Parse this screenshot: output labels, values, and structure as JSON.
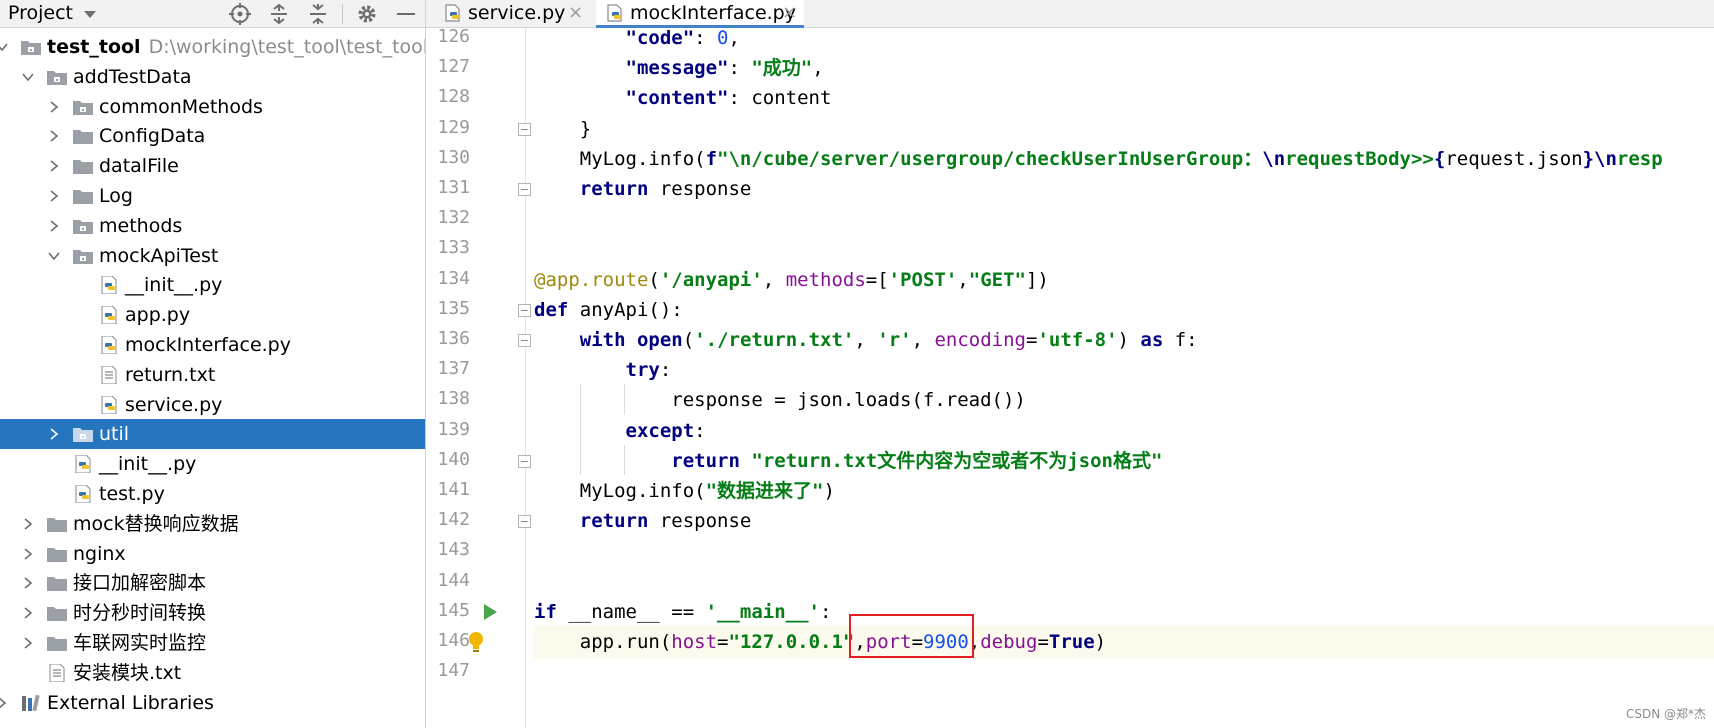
{
  "project_panel": {
    "title": "Project",
    "tree": [
      {
        "label": "test_tool",
        "path": "D:\\working\\test_tool\\test_tool",
        "kind": "module-folder",
        "depth": 0,
        "arrow": "down",
        "bold": true
      },
      {
        "label": "addTestData",
        "kind": "module-folder",
        "depth": 1,
        "arrow": "down"
      },
      {
        "label": "commonMethods",
        "kind": "module-folder",
        "depth": 2,
        "arrow": "right"
      },
      {
        "label": "ConfigData",
        "kind": "folder",
        "depth": 2,
        "arrow": "right"
      },
      {
        "label": "datalFile",
        "kind": "folder",
        "depth": 2,
        "arrow": "right"
      },
      {
        "label": "Log",
        "kind": "folder",
        "depth": 2,
        "arrow": "right"
      },
      {
        "label": "methods",
        "kind": "module-folder",
        "depth": 2,
        "arrow": "right"
      },
      {
        "label": "mockApiTest",
        "kind": "module-folder",
        "depth": 2,
        "arrow": "down"
      },
      {
        "label": "__init__.py",
        "kind": "python-file",
        "depth": 3,
        "arrow": "none"
      },
      {
        "label": "app.py",
        "kind": "python-file",
        "depth": 3,
        "arrow": "none"
      },
      {
        "label": "mockInterface.py",
        "kind": "python-file",
        "depth": 3,
        "arrow": "none"
      },
      {
        "label": "return.txt",
        "kind": "text-file",
        "depth": 3,
        "arrow": "none"
      },
      {
        "label": "service.py",
        "kind": "python-file",
        "depth": 3,
        "arrow": "none"
      },
      {
        "label": "util",
        "kind": "module-folder",
        "depth": 2,
        "arrow": "right",
        "selected": true
      },
      {
        "label": "__init__.py",
        "kind": "python-file",
        "depth": 2,
        "arrow": "none"
      },
      {
        "label": "test.py",
        "kind": "python-file",
        "depth": 2,
        "arrow": "none"
      },
      {
        "label": "mock替换响应数据",
        "kind": "folder",
        "depth": 1,
        "arrow": "right"
      },
      {
        "label": "nginx",
        "kind": "folder",
        "depth": 1,
        "arrow": "right"
      },
      {
        "label": "接口加解密脚本",
        "kind": "folder",
        "depth": 1,
        "arrow": "right"
      },
      {
        "label": "时分秒时间转换",
        "kind": "folder",
        "depth": 1,
        "arrow": "right"
      },
      {
        "label": "车联网实时监控",
        "kind": "folder",
        "depth": 1,
        "arrow": "right"
      },
      {
        "label": "安装模块.txt",
        "kind": "text-file",
        "depth": 1,
        "arrow": "none"
      },
      {
        "label": "External Libraries",
        "kind": "libraries",
        "depth": 0,
        "arrow": "right"
      }
    ]
  },
  "editor": {
    "tabs": [
      {
        "label": "service.py",
        "close": "×",
        "active": false
      },
      {
        "label": "mockInterface.py",
        "close": "×",
        "active": true
      }
    ],
    "line_numbers": [
      "126",
      "127",
      "128",
      "129",
      "130",
      "131",
      "132",
      "133",
      "134",
      "135",
      "136",
      "137",
      "138",
      "139",
      "140",
      "141",
      "142",
      "143",
      "144",
      "145",
      "146",
      "147"
    ],
    "code_lines": [
      [
        {
          "t": "        "
        },
        {
          "c": "sp",
          "t": "\"code\""
        },
        {
          "t": ": "
        },
        {
          "c": "n",
          "t": "0"
        },
        {
          "t": ","
        }
      ],
      [
        {
          "t": "        "
        },
        {
          "c": "sp",
          "t": "\"message\""
        },
        {
          "t": ": "
        },
        {
          "c": "s",
          "t": "\"成功\""
        },
        {
          "t": ","
        }
      ],
      [
        {
          "t": "        "
        },
        {
          "c": "sp",
          "t": "\"content\""
        },
        {
          "t": ": content"
        }
      ],
      [
        {
          "t": "    }"
        }
      ],
      [
        {
          "t": "    MyLog.info("
        },
        {
          "c": "k",
          "t": "f"
        },
        {
          "c": "s",
          "t": "\"\\n/cube/server/usergroup/checkUserInUserGroup："
        },
        {
          "c": "k",
          "t": "\\n"
        },
        {
          "c": "s",
          "t": "requestBody>>"
        },
        {
          "c": "k",
          "t": "{"
        },
        {
          "t": "request.json"
        },
        {
          "c": "k",
          "t": "}\\n"
        },
        {
          "c": "s",
          "t": "resp"
        }
      ],
      [
        {
          "t": "    "
        },
        {
          "c": "k",
          "t": "return"
        },
        {
          "t": " response"
        }
      ],
      [],
      [],
      [
        {
          "c": "d",
          "t": "@app.route"
        },
        {
          "t": "("
        },
        {
          "c": "s",
          "t": "'/anyapi'"
        },
        {
          "t": ", "
        },
        {
          "c": "p",
          "t": "methods"
        },
        {
          "t": "=["
        },
        {
          "c": "s",
          "t": "'POST'"
        },
        {
          "t": ","
        },
        {
          "c": "s",
          "t": "\"GET\""
        },
        {
          "t": "])"
        }
      ],
      [
        {
          "c": "k",
          "t": "def"
        },
        {
          "t": " anyApi():"
        }
      ],
      [
        {
          "t": "    "
        },
        {
          "c": "k",
          "t": "with"
        },
        {
          "t": " "
        },
        {
          "c": "sp",
          "t": "open"
        },
        {
          "t": "("
        },
        {
          "c": "s",
          "t": "'./return.txt'"
        },
        {
          "t": ", "
        },
        {
          "c": "s",
          "t": "'r'"
        },
        {
          "t": ", "
        },
        {
          "c": "p",
          "t": "encoding"
        },
        {
          "t": "="
        },
        {
          "c": "s",
          "t": "'utf-8'"
        },
        {
          "t": ") "
        },
        {
          "c": "k",
          "t": "as"
        },
        {
          "t": " f:"
        }
      ],
      [
        {
          "t": "        "
        },
        {
          "c": "k",
          "t": "try"
        },
        {
          "t": ":"
        }
      ],
      [
        {
          "t": "            response = json.loads(f.read())"
        }
      ],
      [
        {
          "t": "        "
        },
        {
          "c": "k",
          "t": "except"
        },
        {
          "t": ":"
        }
      ],
      [
        {
          "t": "            "
        },
        {
          "c": "k",
          "t": "return"
        },
        {
          "t": " "
        },
        {
          "c": "s",
          "t": "\"return.txt文件内容为空或者不为json格式\""
        }
      ],
      [
        {
          "t": "    MyLog.info("
        },
        {
          "c": "s",
          "t": "\"数据进来了\""
        },
        {
          "t": ")"
        }
      ],
      [
        {
          "t": "    "
        },
        {
          "c": "k",
          "t": "return"
        },
        {
          "t": " response"
        }
      ],
      [],
      [],
      [
        {
          "c": "k",
          "t": "if"
        },
        {
          "t": " __name__ == "
        },
        {
          "c": "s",
          "t": "'__main__'"
        },
        {
          "t": ":"
        }
      ],
      [
        {
          "t": "    app.run("
        },
        {
          "c": "p",
          "t": "host"
        },
        {
          "t": "="
        },
        {
          "c": "s",
          "t": "\"127.0.0.1\""
        },
        {
          "t": ","
        },
        {
          "c": "p",
          "t": "port"
        },
        {
          "t": "="
        },
        {
          "c": "n",
          "t": "9900"
        },
        {
          "t": ","
        },
        {
          "c": "p",
          "t": "debug"
        },
        {
          "t": "="
        },
        {
          "c": "k",
          "t": "True"
        },
        {
          "t": ")"
        }
      ],
      []
    ],
    "current_line": "146"
  },
  "watermark": "CSDN @郑*杰",
  "colors": {
    "keyword": "#000080",
    "string": "#067d17",
    "number": "#1750eb",
    "parameter": "#871094",
    "decorator": "#9e880d",
    "selection": "#2675bf",
    "highlight_box": "#e02020"
  }
}
